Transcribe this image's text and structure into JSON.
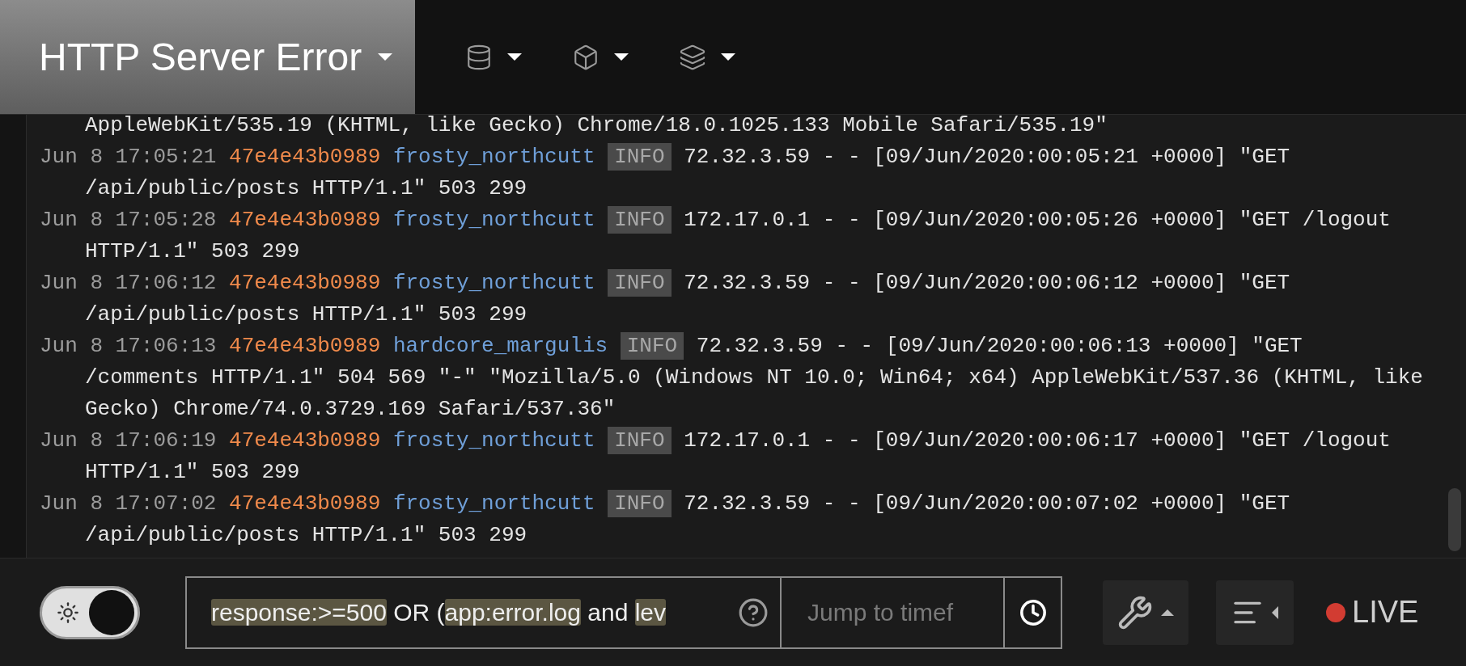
{
  "header": {
    "title": "HTTP Server Error",
    "menus": [
      {
        "kind": "database"
      },
      {
        "kind": "box"
      },
      {
        "kind": "layers"
      }
    ]
  },
  "log": [
    {
      "kind": "continuation",
      "lines": [
        "AppleWebKit/535.19 (KHTML, like Gecko) Chrome/18.0.1025.133 Mobile Safari/535.19\""
      ]
    },
    {
      "kind": "entry",
      "time": "Jun 8 17:05:21",
      "container_id": "47e4e43b0989",
      "container": "frosty_northcutt",
      "level": "INFO",
      "lines": [
        "72.32.3.59 - - [09/Jun/2020:00:05:21 +0000] \"GET",
        "/api/public/posts HTTP/1.1\" 503 299"
      ]
    },
    {
      "kind": "entry",
      "time": "Jun 8 17:05:28",
      "container_id": "47e4e43b0989",
      "container": "frosty_northcutt",
      "level": "INFO",
      "lines": [
        "172.17.0.1 - - [09/Jun/2020:00:05:26 +0000] \"GET /logout",
        "HTTP/1.1\" 503 299"
      ]
    },
    {
      "kind": "entry",
      "time": "Jun 8 17:06:12",
      "container_id": "47e4e43b0989",
      "container": "frosty_northcutt",
      "level": "INFO",
      "lines": [
        "72.32.3.59 - - [09/Jun/2020:00:06:12 +0000] \"GET",
        "/api/public/posts HTTP/1.1\" 503 299"
      ]
    },
    {
      "kind": "entry",
      "time": "Jun 8 17:06:13",
      "container_id": "47e4e43b0989",
      "container": "hardcore_margulis",
      "level": "INFO",
      "lines": [
        "72.32.3.59 - - [09/Jun/2020:00:06:13 +0000] \"GET",
        "/comments HTTP/1.1\" 504 569 \"-\" \"Mozilla/5.0 (Windows NT 10.0; Win64; x64) AppleWebKit/537.36 (KHTML, like",
        "Gecko) Chrome/74.0.3729.169 Safari/537.36\""
      ]
    },
    {
      "kind": "entry",
      "time": "Jun 8 17:06:19",
      "container_id": "47e4e43b0989",
      "container": "frosty_northcutt",
      "level": "INFO",
      "lines": [
        "172.17.0.1 - - [09/Jun/2020:00:06:17 +0000] \"GET /logout",
        "HTTP/1.1\" 503 299"
      ]
    },
    {
      "kind": "entry",
      "time": "Jun 8 17:07:02",
      "container_id": "47e4e43b0989",
      "container": "frosty_northcutt",
      "level": "INFO",
      "lines": [
        "72.32.3.59 - - [09/Jun/2020:00:07:02 +0000] \"GET",
        "/api/public/posts HTTP/1.1\" 503 299"
      ]
    }
  ],
  "footer": {
    "theme_toggle": {
      "on": true
    },
    "query": [
      {
        "text": "response:>=500",
        "highlighted": true
      },
      {
        "text": " OR (",
        "highlighted": false
      },
      {
        "text": "app:error.log",
        "highlighted": true
      },
      {
        "text": " and ",
        "highlighted": false
      },
      {
        "text": "lev",
        "highlighted": true
      }
    ],
    "jump": {
      "placeholder": "Jump to timef"
    },
    "live": {
      "label": "LIVE",
      "on": true
    }
  }
}
